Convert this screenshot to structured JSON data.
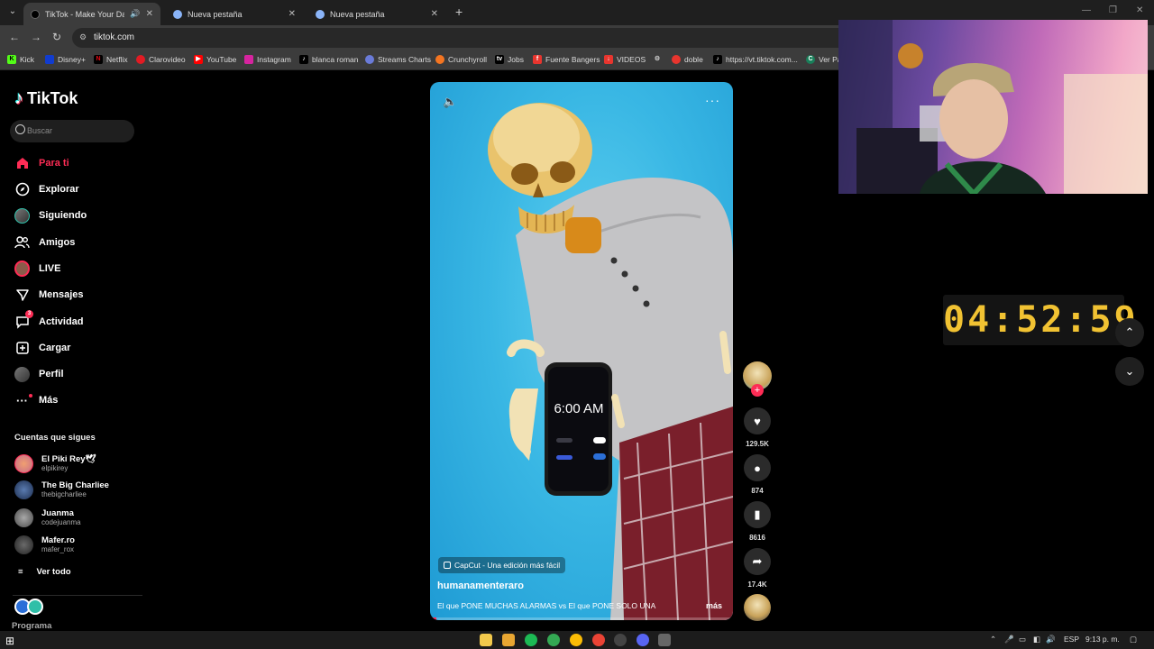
{
  "browser": {
    "tabs": [
      {
        "title": "TikTok - Make Your Day",
        "active": true,
        "color": "#000000"
      },
      {
        "title": "Nueva pestaña",
        "active": false,
        "color": "#8ab4f8"
      },
      {
        "title": "Nueva pestaña",
        "active": false,
        "color": "#8ab4f8"
      }
    ],
    "url": "tiktok.com",
    "bookmarks": [
      "Kick",
      "Disney+",
      "Netflix",
      "Clarovideo",
      "YouTube",
      "Instagram",
      "blanca roman",
      "Streams Charts",
      "Crunchyroll",
      "Jobs",
      "Fuente Bangers",
      "VIDEOS",
      "doble",
      "https://vt.tiktok.com...",
      "Ver Pa"
    ]
  },
  "sidebar": {
    "logo": "TikTok",
    "search_placeholder": "Buscar",
    "items": [
      {
        "label": "Para ti",
        "icon": "home-icon"
      },
      {
        "label": "Explorar",
        "icon": "compass-icon"
      },
      {
        "label": "Siguiendo",
        "icon": "following-avatar-icon"
      },
      {
        "label": "Amigos",
        "icon": "friends-icon"
      },
      {
        "label": "LIVE",
        "icon": "live-icon"
      },
      {
        "label": "Mensajes",
        "icon": "messages-icon"
      },
      {
        "label": "Actividad",
        "icon": "activity-icon",
        "badge": "3"
      },
      {
        "label": "Cargar",
        "icon": "upload-icon"
      },
      {
        "label": "Perfil",
        "icon": "profile-icon"
      },
      {
        "label": "Más",
        "icon": "more-icon"
      }
    ],
    "following_title": "Cuentas que sigues",
    "accounts": [
      {
        "name": "El Piki Rey🕊",
        "handle": "elpikirey",
        "color": "#c76a8a"
      },
      {
        "name": "The Big Charliee",
        "handle": "thebigcharliee",
        "color": "#2f4a7a"
      },
      {
        "name": "Juanma",
        "handle": "codejuanma",
        "color": "#7a7a7a"
      },
      {
        "name": "Mafer.ro",
        "handle": "mafer_rox",
        "color": "#3a3a3a"
      }
    ],
    "see_all": "Ver todo",
    "program_label": "Programa"
  },
  "video": {
    "capcut_label": "CapCut - Una edición más fácil",
    "username": "humanamenteraro",
    "description": "El que PONE MUCHAS ALARMAS vs El que PONE SOLO UNA",
    "more": "más",
    "phone_time": "6:00 AM",
    "progress": 0.02
  },
  "actions": {
    "likes": "129.5K",
    "comments": "874",
    "saves": "8616",
    "shares": "17.4K"
  },
  "overlay": {
    "timer": "04:52:59"
  },
  "taskbar": {
    "lang": "ESP",
    "clock": "9:13 p. m."
  },
  "colors": {
    "accent": "#fe2c55",
    "timer": "#f1c232"
  }
}
